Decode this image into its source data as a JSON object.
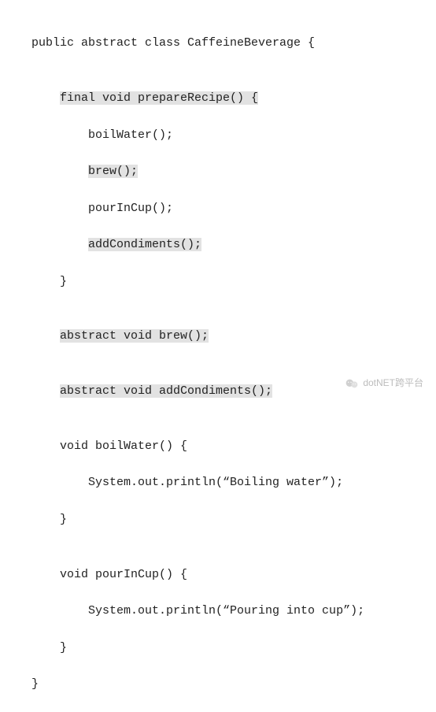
{
  "code": {
    "l1": "public abstract class CaffeineBeverage {",
    "l2": "",
    "l3p": "    ",
    "l3h": "final void prepareRecipe() {",
    "l4": "        boilWater();",
    "l5p": "        ",
    "l5h": "brew();",
    "l6": "        pourInCup();",
    "l7p": "        ",
    "l7h": "addCondiments();",
    "l8": "    }",
    "l9": "",
    "l10p": "    ",
    "l10h": "abstract void brew();",
    "l11": "",
    "l12p": "    ",
    "l12h": "abstract void addCondiments();",
    "l13": "",
    "l14": "    void boilWater() {",
    "l15": "        System.out.println(“Boiling water”);",
    "l16": "    }",
    "l17": "",
    "l18": "    void pourInCup() {",
    "l19": "        System.out.println(“Pouring into cup”);",
    "l20": "    }",
    "l21": "}"
  },
  "footer": {
    "label": "dotNET跨平台"
  }
}
